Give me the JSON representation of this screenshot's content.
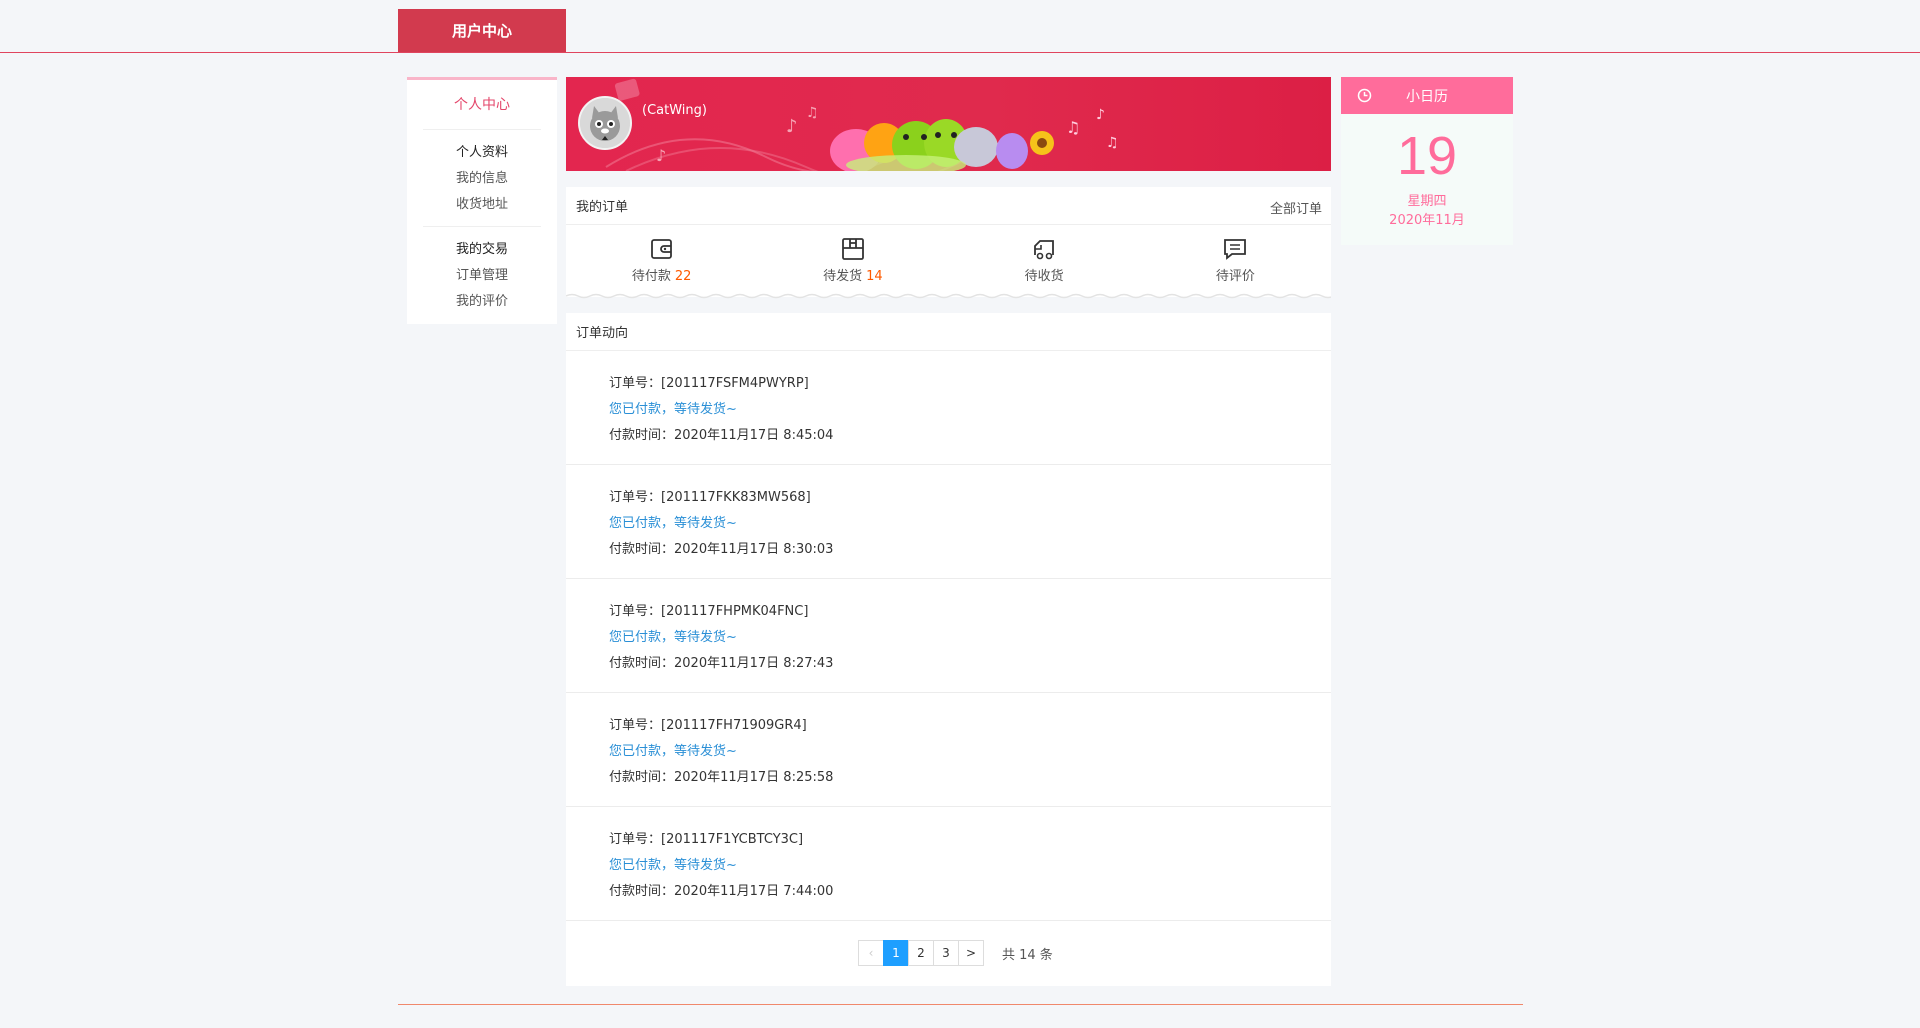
{
  "header": {
    "tab_label": "用户中心"
  },
  "sidebar": {
    "home": "个人中心",
    "groups": [
      {
        "title": "个人资料",
        "items": [
          "我的信息",
          "收货地址"
        ]
      },
      {
        "title": "我的交易",
        "items": [
          "订单管理",
          "我的评价"
        ]
      }
    ]
  },
  "profile": {
    "username": "(CatWing)"
  },
  "orders": {
    "title": "我的订单",
    "all_link": "全部订单",
    "statuses": [
      {
        "label": "待付款",
        "count": "22",
        "icon": "wallet-icon"
      },
      {
        "label": "待发货",
        "count": "14",
        "icon": "package-icon"
      },
      {
        "label": "待收货",
        "count": "",
        "icon": "truck-icon"
      },
      {
        "label": "待评价",
        "count": "",
        "icon": "comment-icon"
      }
    ]
  },
  "feed": {
    "title": "订单动向",
    "items": [
      {
        "order_no": "订单号：[201117FSFM4PWYRP]",
        "message": "您已付款，等待发货~",
        "time": "付款时间：2020年11月17日 8:45:04"
      },
      {
        "order_no": "订单号：[201117FKK83MW568]",
        "message": "您已付款，等待发货~",
        "time": "付款时间：2020年11月17日 8:30:03"
      },
      {
        "order_no": "订单号：[201117FHPMK04FNC]",
        "message": "您已付款，等待发货~",
        "time": "付款时间：2020年11月17日 8:27:43"
      },
      {
        "order_no": "订单号：[201117FH71909GR4]",
        "message": "您已付款，等待发货~",
        "time": "付款时间：2020年11月17日 8:25:58"
      },
      {
        "order_no": "订单号：[201117F1YCBTCY3C]",
        "message": "您已付款，等待发货~",
        "time": "付款时间：2020年11月17日 7:44:00"
      }
    ]
  },
  "pagination": {
    "prev": "‹",
    "pages": [
      "1",
      "2",
      "3"
    ],
    "current": "1",
    "next": ">",
    "total": "共 14 条"
  },
  "calendar": {
    "title": "小日历",
    "day": "19",
    "weekday": "星期四",
    "month": "2020年11月"
  },
  "colors": {
    "brand_red": "#d23a4e",
    "banner_red": "#e02a4d",
    "accent_pink": "#ff6c9b",
    "link_blue": "#2a8fd6",
    "count_orange": "#ff5a00",
    "pager_active": "#1e9fff"
  }
}
